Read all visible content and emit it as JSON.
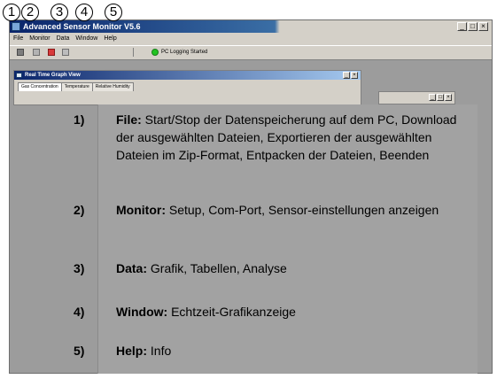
{
  "callouts": [
    "1",
    "2",
    "3",
    "4",
    "5"
  ],
  "app": {
    "title": "Advanced Sensor Monitor V5.6",
    "window_buttons": [
      "_",
      "□",
      "×"
    ]
  },
  "menu": [
    "File",
    "Monitor",
    "Data",
    "Window",
    "Help"
  ],
  "toolbar": {
    "status_text": "PC Logging Started",
    "status_color": "#21c321"
  },
  "graph_window": {
    "title": "Real Time Graph View",
    "tabs": [
      "Gas Concentration",
      "Temperature",
      "Relative Humidity"
    ]
  },
  "annotations": [
    {
      "number": "1)",
      "label": "File:",
      "text": " Start/Stop der Datenspeicherung auf dem PC, Download der ausgewählten Dateien, Exportieren der ausgewählten Dateien im Zip-Format, Entpacken der Dateien, Beenden"
    },
    {
      "number": "2)",
      "label": "Monitor:",
      "text": " Setup, Com-Port, Sensor-einstellungen anzeigen"
    },
    {
      "number": "3)",
      "label": "Data:",
      "text": " Grafik, Tabellen, Analyse"
    },
    {
      "number": "4)",
      "label": "Window:",
      "text": " Echtzeit-Grafikanzeige"
    },
    {
      "number": "5)",
      "label": "Help:",
      "text": " Info"
    }
  ]
}
